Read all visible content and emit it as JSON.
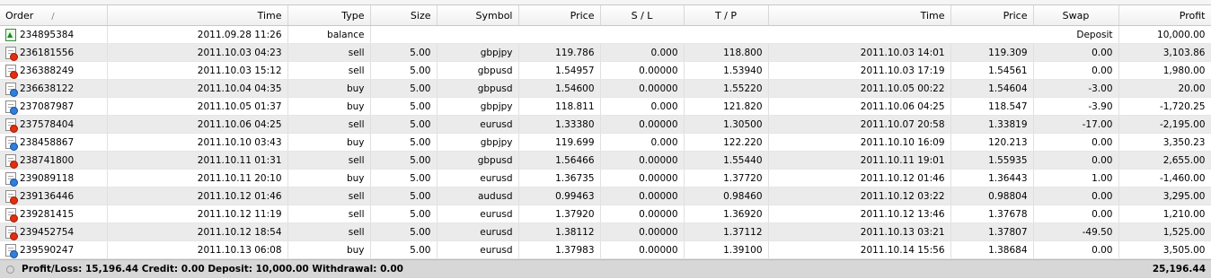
{
  "columns": {
    "order": "Order",
    "sort_indicator": "/",
    "time": "Time",
    "type": "Type",
    "size": "Size",
    "symbol": "Symbol",
    "price": "Price",
    "sl": "S / L",
    "tp": "T / P",
    "close_time": "Time",
    "close_price": "Price",
    "swap": "Swap",
    "profit": "Profit"
  },
  "balance_row": {
    "order": "234895384",
    "time": "2011.09.28 11:26",
    "type": "balance",
    "comment": "Deposit",
    "profit": "10,000.00",
    "icon": "balance-arrow-icon"
  },
  "rows": [
    {
      "order": "236181556",
      "time": "2011.10.03 04:23",
      "type": "sell",
      "size": "5.00",
      "symbol": "gbpjpy",
      "price": "119.786",
      "sl": "0.000",
      "tp": "118.800",
      "close_time": "2011.10.03 14:01",
      "close_price": "119.309",
      "swap": "0.00",
      "profit": "3,103.86"
    },
    {
      "order": "236388249",
      "time": "2011.10.03 15:12",
      "type": "sell",
      "size": "5.00",
      "symbol": "gbpusd",
      "price": "1.54957",
      "sl": "0.00000",
      "tp": "1.53940",
      "close_time": "2011.10.03 17:19",
      "close_price": "1.54561",
      "swap": "0.00",
      "profit": "1,980.00"
    },
    {
      "order": "236638122",
      "time": "2011.10.04 04:35",
      "type": "buy",
      "size": "5.00",
      "symbol": "gbpusd",
      "price": "1.54600",
      "sl": "0.00000",
      "tp": "1.55220",
      "close_time": "2011.10.05 00:22",
      "close_price": "1.54604",
      "swap": "-3.00",
      "profit": "20.00"
    },
    {
      "order": "237087987",
      "time": "2011.10.05 01:37",
      "type": "buy",
      "size": "5.00",
      "symbol": "gbpjpy",
      "price": "118.811",
      "sl": "0.000",
      "tp": "121.820",
      "close_time": "2011.10.06 04:25",
      "close_price": "118.547",
      "swap": "-3.90",
      "profit": "-1,720.25"
    },
    {
      "order": "237578404",
      "time": "2011.10.06 04:25",
      "type": "sell",
      "size": "5.00",
      "symbol": "eurusd",
      "price": "1.33380",
      "sl": "0.00000",
      "tp": "1.30500",
      "close_time": "2011.10.07 20:58",
      "close_price": "1.33819",
      "swap": "-17.00",
      "profit": "-2,195.00"
    },
    {
      "order": "238458867",
      "time": "2011.10.10 03:43",
      "type": "buy",
      "size": "5.00",
      "symbol": "gbpjpy",
      "price": "119.699",
      "sl": "0.000",
      "tp": "122.220",
      "close_time": "2011.10.10 16:09",
      "close_price": "120.213",
      "swap": "0.00",
      "profit": "3,350.23"
    },
    {
      "order": "238741800",
      "time": "2011.10.11 01:31",
      "type": "sell",
      "size": "5.00",
      "symbol": "gbpusd",
      "price": "1.56466",
      "sl": "0.00000",
      "tp": "1.55440",
      "close_time": "2011.10.11 19:01",
      "close_price": "1.55935",
      "swap": "0.00",
      "profit": "2,655.00"
    },
    {
      "order": "239089118",
      "time": "2011.10.11 20:10",
      "type": "buy",
      "size": "5.00",
      "symbol": "eurusd",
      "price": "1.36735",
      "sl": "0.00000",
      "tp": "1.37720",
      "close_time": "2011.10.12 01:46",
      "close_price": "1.36443",
      "swap": "1.00",
      "profit": "-1,460.00"
    },
    {
      "order": "239136446",
      "time": "2011.10.12 01:46",
      "type": "sell",
      "size": "5.00",
      "symbol": "audusd",
      "price": "0.99463",
      "sl": "0.00000",
      "tp": "0.98460",
      "close_time": "2011.10.12 03:22",
      "close_price": "0.98804",
      "swap": "0.00",
      "profit": "3,295.00"
    },
    {
      "order": "239281415",
      "time": "2011.10.12 11:19",
      "type": "sell",
      "size": "5.00",
      "symbol": "eurusd",
      "price": "1.37920",
      "sl": "0.00000",
      "tp": "1.36920",
      "close_time": "2011.10.12 13:46",
      "close_price": "1.37678",
      "swap": "0.00",
      "profit": "1,210.00"
    },
    {
      "order": "239452754",
      "time": "2011.10.12 18:54",
      "type": "sell",
      "size": "5.00",
      "symbol": "eurusd",
      "price": "1.38112",
      "sl": "0.00000",
      "tp": "1.37112",
      "close_time": "2011.10.13 03:21",
      "close_price": "1.37807",
      "swap": "-49.50",
      "profit": "1,525.00"
    },
    {
      "order": "239590247",
      "time": "2011.10.13 06:08",
      "type": "buy",
      "size": "5.00",
      "symbol": "eurusd",
      "price": "1.37983",
      "sl": "0.00000",
      "tp": "1.39100",
      "close_time": "2011.10.14 15:56",
      "close_price": "1.38684",
      "swap": "0.00",
      "profit": "3,505.00"
    }
  ],
  "footer": {
    "summary": "Profit/Loss: 15,196.44  Credit: 0.00  Deposit: 10,000.00  Withdrawal: 0.00",
    "total": "25,196.44"
  },
  "colors": {
    "sell": "#e03010",
    "buy": "#2f7fdc",
    "footer_bg": "#d7d7d7",
    "alt_row": "#ebebeb"
  }
}
